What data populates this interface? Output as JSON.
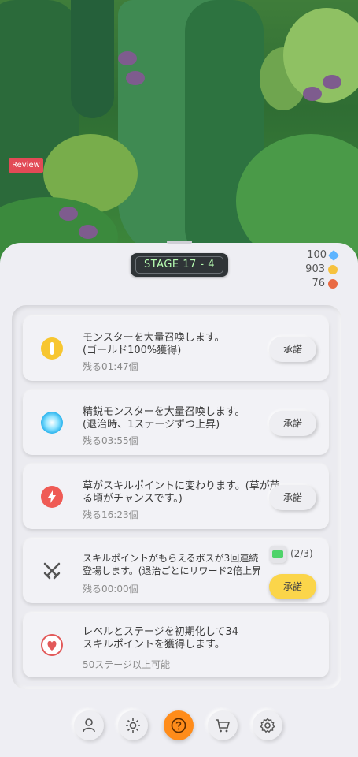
{
  "review_tag": "Review",
  "stage": {
    "label": "STAGE 17 - 4"
  },
  "resources": [
    {
      "value": "100",
      "icon": "gem-icon",
      "color": "#5db4ff"
    },
    {
      "value": "903",
      "icon": "coin-icon",
      "color": "#f6c23e"
    },
    {
      "value": "76",
      "icon": "orb-icon",
      "color": "#e96a43"
    }
  ],
  "cards": [
    {
      "icon": "coin-icon",
      "line1": "モンスターを大量召喚します。",
      "line2": "(ゴールド100%獲得)",
      "sub": "残る01:47個",
      "button": "承諾"
    },
    {
      "icon": "spark-burst-icon",
      "line1": "精鋭モンスターを大量召喚します。",
      "line2": "(退治時、1ステージずつ上昇)",
      "sub": "残る03:55個",
      "button": "承諾"
    },
    {
      "icon": "lightning-icon",
      "line1": "草がスキルポイントに変わります。(草が茂",
      "line2": "る頃がチャンスです。)",
      "sub": "残る16:23個",
      "button": "承諾"
    },
    {
      "icon": "crossed-swords-icon",
      "line1": "スキルポイントがもらえるボスが3回連続",
      "line2": "登場します。(退治ごとにリワード2倍上昇",
      "sub": "残る00:00個",
      "button": "承諾",
      "ad_count": "(2/3)"
    },
    {
      "icon": "heart-icon",
      "line1": "レベルとステージを初期化して34",
      "line2": "スキルポイントを獲得します。",
      "sub": "50ステージ以上可能"
    }
  ],
  "nav": [
    {
      "icon": "user-icon",
      "active": false
    },
    {
      "icon": "sun-skill-icon",
      "active": false
    },
    {
      "icon": "question-icon",
      "active": true
    },
    {
      "icon": "cart-icon",
      "active": false
    },
    {
      "icon": "gear-icon",
      "active": false
    }
  ],
  "colors": {
    "accent_orange": "#ff8c1a",
    "accept_yellow": "#fbd54a",
    "stage_text": "#b8ffb3",
    "review_red": "#e24a56"
  }
}
